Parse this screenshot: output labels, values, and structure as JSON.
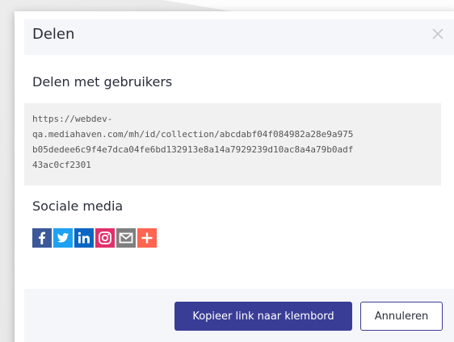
{
  "dialog": {
    "title": "Delen",
    "close_icon": "close-icon"
  },
  "share_users": {
    "title": "Delen met gebruikers",
    "link": "https://webdev-\nqa.mediahaven.com/mh/id/collection/abcdabf04f084982a28e9a975\nb05dedee6c9f4e7dca04fe6bd132913e8a14a7929239d10ac8a4a79b0adf\n43ac0cf2301"
  },
  "social": {
    "title": "Sociale media",
    "items": [
      {
        "icon": "facebook-icon",
        "color": "#3b5998"
      },
      {
        "icon": "twitter-icon",
        "color": "#1da1f2"
      },
      {
        "icon": "linkedin-icon",
        "color": "#0a66c2"
      },
      {
        "icon": "instagram-icon",
        "color": "#e1306c"
      },
      {
        "icon": "email-icon",
        "color": "#7f7f7f"
      },
      {
        "icon": "plus-icon",
        "color": "#ff6550"
      }
    ]
  },
  "footer": {
    "copy_label": "Kopieer link naar klembord",
    "cancel_label": "Annuleren"
  },
  "colors": {
    "primary": "#3a3d96",
    "header_bg": "#f5f6f9",
    "link_box_bg": "#f1f1f1"
  }
}
